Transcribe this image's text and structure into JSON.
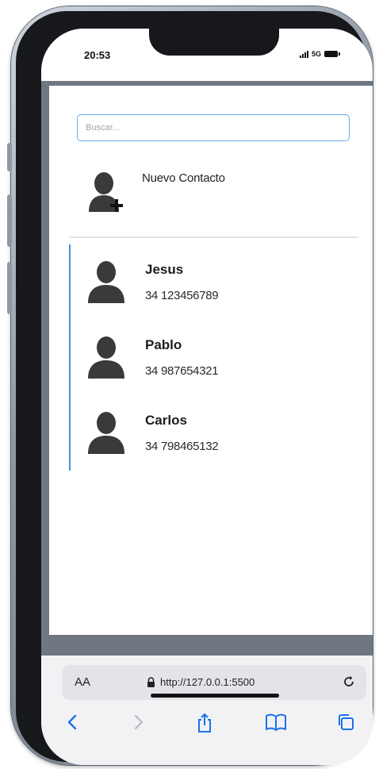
{
  "status_bar": {
    "time": "20:53",
    "network": "5G"
  },
  "search": {
    "placeholder": "Buscar..."
  },
  "new_contact": {
    "label": "Nuevo Contacto"
  },
  "contacts": [
    {
      "name": "Jesus",
      "phone": "34 123456789"
    },
    {
      "name": "Pablo",
      "phone": "34 987654321"
    },
    {
      "name": "Carlos",
      "phone": "34 798465132"
    }
  ],
  "browser": {
    "text_size_label": "AA",
    "url": "http://127.0.0.1:5500",
    "nav": [
      "back",
      "forward",
      "share",
      "bookmarks",
      "tabs"
    ]
  },
  "colors": {
    "accent": "#4a90e2",
    "input_border": "#6aa7f0",
    "toolbar_blue": "#1a73e8",
    "avatar_gray": "#3a3a3a"
  }
}
